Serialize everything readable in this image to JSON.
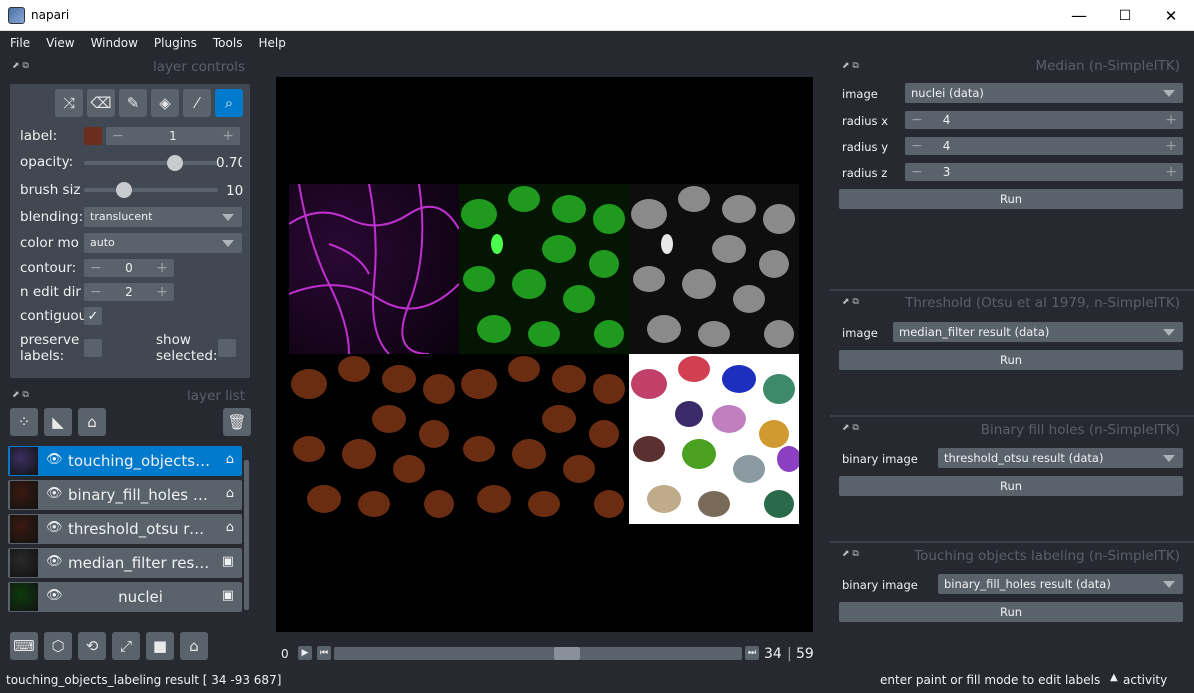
{
  "window": {
    "title": "napari",
    "minimize": "—",
    "maximize": "☐",
    "close": "✕"
  },
  "menu": [
    "File",
    "View",
    "Window",
    "Plugins",
    "Tools",
    "Help"
  ],
  "layer_controls": {
    "header": "layer controls",
    "label_label": "label:",
    "label_value": "1",
    "label_color": "#6b2d1e",
    "opacity_label": "opacity:",
    "opacity_value": "0.70",
    "opacity_fraction": 0.7,
    "brush_label": "brush siz",
    "brush_value": "10",
    "brush_fraction": 0.27,
    "blending_label": "blending:",
    "blending_value": "translucent",
    "colormode_label": "color mo",
    "colormode_value": "auto",
    "contour_label": "contour:",
    "contour_value": "0",
    "nedit_label": "n edit dir",
    "nedit_value": "2",
    "contiguous_label": "contiguou",
    "preserve_label": "preserve labels:",
    "show_selected_label": "show selected:"
  },
  "layer_list": {
    "header": "layer list",
    "layers": [
      {
        "name": "touching_objects_l...",
        "selected": true,
        "type": "labels"
      },
      {
        "name": "binary_fill_holes re...",
        "selected": false,
        "type": "labels"
      },
      {
        "name": "threshold_otsu res...",
        "selected": false,
        "type": "labels"
      },
      {
        "name": "median_filter result",
        "selected": false,
        "type": "image"
      },
      {
        "name": "nuclei",
        "selected": false,
        "type": "image"
      }
    ]
  },
  "dims": {
    "start": "0",
    "current": "34",
    "max": "59",
    "fraction": 0.576
  },
  "panels": {
    "median": {
      "title": "Median (n-SimpleITK)",
      "image_label": "image",
      "image_value": "nuclei (data)",
      "rx_label": "radius x",
      "rx": "4",
      "ry_label": "radius y",
      "ry": "4",
      "rz_label": "radius z",
      "rz": "3",
      "run": "Run"
    },
    "threshold": {
      "title": "Threshold (Otsu et al 1979, n-SimpleITK)",
      "image_label": "image",
      "image_value": "median_filter result (data)",
      "run": "Run"
    },
    "fill": {
      "title": "Binary fill holes (n-SimpleITK)",
      "image_label": "binary image",
      "image_value": "threshold_otsu result (data)",
      "run": "Run"
    },
    "touching": {
      "title": "Touching objects labeling (n-SimpleITK)",
      "image_label": "binary image",
      "image_value": "binary_fill_holes result (data)",
      "run": "Run"
    }
  },
  "status": {
    "left": "touching_objects_labeling result [ 34 -93 687]",
    "center": "enter paint or fill mode to edit labels",
    "activity": "activity"
  }
}
